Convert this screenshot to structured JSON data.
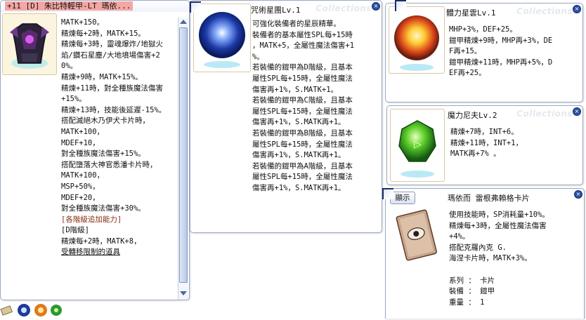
{
  "colors": {
    "title_highlight": "#f4a7a3",
    "border": "#9aa9c4",
    "accent": "#1b2f66",
    "link_text": "#8a2b14"
  },
  "watermark": "Collections",
  "main_window": {
    "title": "+11 [D] 朱比特輕甲-LT 瑪依...",
    "lines": [
      "MATK+150。",
      "精煉每+2時，MATK+15。",
      "精煉每+3時，靈魂爆炸/地獄火",
      "焰/鑽石星塵/大地墳場傷害+2",
      "0%。",
      "精煉+9時，MATK+15%。",
      "精煉+11時，對全種族魔法傷害",
      "+15%。",
      "精煉+13時，技能後延遲-15%。",
      "搭配滅絕木乃伊犬卡片時，",
      "MATK+100，",
      "MDEF+10，",
      "對全種族魔法傷害+15%。",
      "搭配墮落大神官悉潘卡片時，",
      "MATK+100，",
      "MSP+50%，",
      "MDEF+20，",
      "對全種族魔法傷害+30%。",
      "[各階級追加能力]",
      "[D階級]",
      "精煉每+2時，MATK+8，",
      "受轉移限制的道具"
    ]
  },
  "star_window": {
    "title": "咒術星團Lv.1",
    "lines": [
      "可強化裝備者的星辰精華。",
      "裝備者的基本屬性SPL每+15時",
      "，MATK+5，全屬性魔法傷害+1",
      "%。",
      "若裝備的鎧甲為D階級，且基本",
      "屬性SPL每+15時，全屬性魔法",
      "傷害再+1%，S.MATK+1。",
      "若裝備的鎧甲為C階級，且基本",
      "屬性SPL每+15時，全屬性魔法",
      "傷害再+1%，S.MATK再+1。",
      "若裝備的鎧甲為B階級，且基本",
      "屬性SPL每+15時，全屬性魔法",
      "傷害再+1%，S.MATK再+1。",
      "若裝備的鎧甲為A階級，且基本",
      "屬性SPL每+15時，全屬性魔法",
      "傷害再+1%，S.MATK再+1。"
    ]
  },
  "body_window": {
    "title": "體力星雲Lv.1",
    "lines": [
      "MHP+3%，DEF+25。",
      "鎧甲精煉+9時，MHP再+3%，DE",
      "F再+15。",
      "鎧甲精煉+11時，MHP再+5%，D",
      "EF再+25。"
    ]
  },
  "magic_window": {
    "title": "魔力尼夫Lv.2",
    "lines": [
      "精煉+7時，INT+6。",
      "精煉+11時，INT+1，",
      "MATK再+7% 。"
    ]
  },
  "card_window": {
    "title": "瑪依而 雷根弗賴格卡片",
    "show_button": "顯示",
    "lines": [
      "使用技能時，SP消耗量+10%。",
      "精煉每+3時，全屬性魔法傷害",
      "+4%。",
      "搭配克羅內克 G.",
      "海涅卡片時，MATK+3%。",
      "",
      "系列 ： 卡片",
      "裝備 ： 鎧甲",
      "重量 ： 1"
    ]
  },
  "bottom_icons": [
    "card-icon",
    "blue-star-icon",
    "orange-nebula-icon",
    "green-gem-icon"
  ]
}
